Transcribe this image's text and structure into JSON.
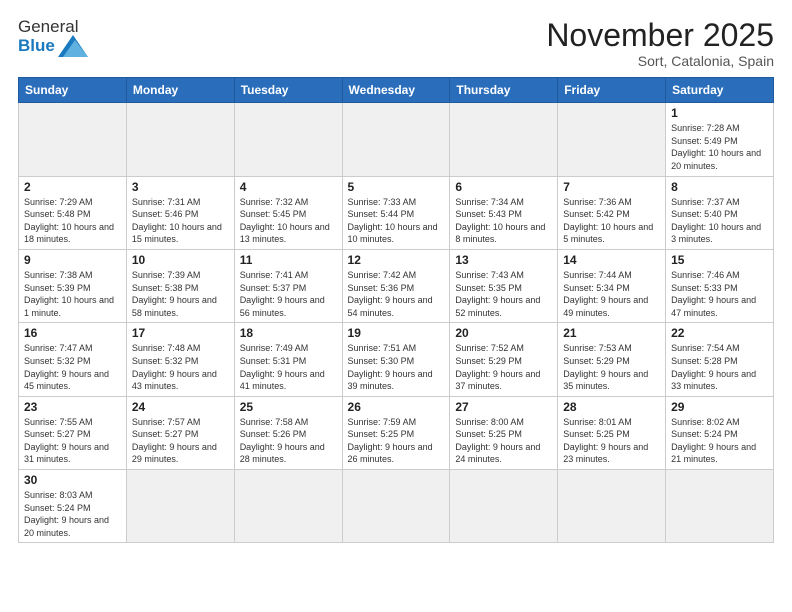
{
  "logo": {
    "text_general": "General",
    "text_blue": "Blue"
  },
  "header": {
    "month": "November 2025",
    "location": "Sort, Catalonia, Spain"
  },
  "days_of_week": [
    "Sunday",
    "Monday",
    "Tuesday",
    "Wednesday",
    "Thursday",
    "Friday",
    "Saturday"
  ],
  "weeks": [
    [
      {
        "day": "",
        "info": ""
      },
      {
        "day": "",
        "info": ""
      },
      {
        "day": "",
        "info": ""
      },
      {
        "day": "",
        "info": ""
      },
      {
        "day": "",
        "info": ""
      },
      {
        "day": "",
        "info": ""
      },
      {
        "day": "1",
        "info": "Sunrise: 7:28 AM\nSunset: 5:49 PM\nDaylight: 10 hours\nand 20 minutes."
      }
    ],
    [
      {
        "day": "2",
        "info": "Sunrise: 7:29 AM\nSunset: 5:48 PM\nDaylight: 10 hours\nand 18 minutes."
      },
      {
        "day": "3",
        "info": "Sunrise: 7:31 AM\nSunset: 5:46 PM\nDaylight: 10 hours\nand 15 minutes."
      },
      {
        "day": "4",
        "info": "Sunrise: 7:32 AM\nSunset: 5:45 PM\nDaylight: 10 hours\nand 13 minutes."
      },
      {
        "day": "5",
        "info": "Sunrise: 7:33 AM\nSunset: 5:44 PM\nDaylight: 10 hours\nand 10 minutes."
      },
      {
        "day": "6",
        "info": "Sunrise: 7:34 AM\nSunset: 5:43 PM\nDaylight: 10 hours\nand 8 minutes."
      },
      {
        "day": "7",
        "info": "Sunrise: 7:36 AM\nSunset: 5:42 PM\nDaylight: 10 hours\nand 5 minutes."
      },
      {
        "day": "8",
        "info": "Sunrise: 7:37 AM\nSunset: 5:40 PM\nDaylight: 10 hours\nand 3 minutes."
      }
    ],
    [
      {
        "day": "9",
        "info": "Sunrise: 7:38 AM\nSunset: 5:39 PM\nDaylight: 10 hours\nand 1 minute."
      },
      {
        "day": "10",
        "info": "Sunrise: 7:39 AM\nSunset: 5:38 PM\nDaylight: 9 hours\nand 58 minutes."
      },
      {
        "day": "11",
        "info": "Sunrise: 7:41 AM\nSunset: 5:37 PM\nDaylight: 9 hours\nand 56 minutes."
      },
      {
        "day": "12",
        "info": "Sunrise: 7:42 AM\nSunset: 5:36 PM\nDaylight: 9 hours\nand 54 minutes."
      },
      {
        "day": "13",
        "info": "Sunrise: 7:43 AM\nSunset: 5:35 PM\nDaylight: 9 hours\nand 52 minutes."
      },
      {
        "day": "14",
        "info": "Sunrise: 7:44 AM\nSunset: 5:34 PM\nDaylight: 9 hours\nand 49 minutes."
      },
      {
        "day": "15",
        "info": "Sunrise: 7:46 AM\nSunset: 5:33 PM\nDaylight: 9 hours\nand 47 minutes."
      }
    ],
    [
      {
        "day": "16",
        "info": "Sunrise: 7:47 AM\nSunset: 5:32 PM\nDaylight: 9 hours\nand 45 minutes."
      },
      {
        "day": "17",
        "info": "Sunrise: 7:48 AM\nSunset: 5:32 PM\nDaylight: 9 hours\nand 43 minutes."
      },
      {
        "day": "18",
        "info": "Sunrise: 7:49 AM\nSunset: 5:31 PM\nDaylight: 9 hours\nand 41 minutes."
      },
      {
        "day": "19",
        "info": "Sunrise: 7:51 AM\nSunset: 5:30 PM\nDaylight: 9 hours\nand 39 minutes."
      },
      {
        "day": "20",
        "info": "Sunrise: 7:52 AM\nSunset: 5:29 PM\nDaylight: 9 hours\nand 37 minutes."
      },
      {
        "day": "21",
        "info": "Sunrise: 7:53 AM\nSunset: 5:29 PM\nDaylight: 9 hours\nand 35 minutes."
      },
      {
        "day": "22",
        "info": "Sunrise: 7:54 AM\nSunset: 5:28 PM\nDaylight: 9 hours\nand 33 minutes."
      }
    ],
    [
      {
        "day": "23",
        "info": "Sunrise: 7:55 AM\nSunset: 5:27 PM\nDaylight: 9 hours\nand 31 minutes."
      },
      {
        "day": "24",
        "info": "Sunrise: 7:57 AM\nSunset: 5:27 PM\nDaylight: 9 hours\nand 29 minutes."
      },
      {
        "day": "25",
        "info": "Sunrise: 7:58 AM\nSunset: 5:26 PM\nDaylight: 9 hours\nand 28 minutes."
      },
      {
        "day": "26",
        "info": "Sunrise: 7:59 AM\nSunset: 5:25 PM\nDaylight: 9 hours\nand 26 minutes."
      },
      {
        "day": "27",
        "info": "Sunrise: 8:00 AM\nSunset: 5:25 PM\nDaylight: 9 hours\nand 24 minutes."
      },
      {
        "day": "28",
        "info": "Sunrise: 8:01 AM\nSunset: 5:25 PM\nDaylight: 9 hours\nand 23 minutes."
      },
      {
        "day": "29",
        "info": "Sunrise: 8:02 AM\nSunset: 5:24 PM\nDaylight: 9 hours\nand 21 minutes."
      }
    ],
    [
      {
        "day": "30",
        "info": "Sunrise: 8:03 AM\nSunset: 5:24 PM\nDaylight: 9 hours\nand 20 minutes."
      },
      {
        "day": "",
        "info": ""
      },
      {
        "day": "",
        "info": ""
      },
      {
        "day": "",
        "info": ""
      },
      {
        "day": "",
        "info": ""
      },
      {
        "day": "",
        "info": ""
      },
      {
        "day": "",
        "info": ""
      }
    ]
  ]
}
